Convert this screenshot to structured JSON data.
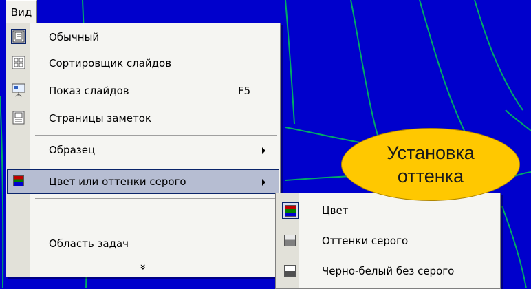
{
  "menubar": {
    "tab_label": "Вид"
  },
  "menu": {
    "items": [
      {
        "label": "Обычный",
        "icon": "normal-view-icon"
      },
      {
        "label": "Сортировщик слайдов",
        "icon": "slide-sorter-icon"
      },
      {
        "label": "Показ слайдов",
        "shortcut": "F5",
        "icon": "slide-show-icon"
      },
      {
        "label": "Страницы заметок",
        "icon": "notes-page-icon"
      },
      {
        "label": "Образец"
      },
      {
        "label": "Цвет или оттенки серого",
        "icon": "color-grayscale-icon"
      },
      {
        "label": "Область задач"
      }
    ],
    "expand_glyph": "»"
  },
  "submenu": {
    "items": [
      {
        "label": "Цвет",
        "icon": "color-icon"
      },
      {
        "label": "Оттенки серого",
        "icon": "grayscale-icon"
      },
      {
        "label": "Черно-белый без серого",
        "icon": "black-white-icon"
      }
    ]
  },
  "callout": {
    "line1": "Установка",
    "line2": "оттенка"
  },
  "colors": {
    "background": "#0000cc",
    "grid_lines": "#00aa66",
    "callout_fill": "#ffc800",
    "highlight": "#b6bdd2"
  }
}
